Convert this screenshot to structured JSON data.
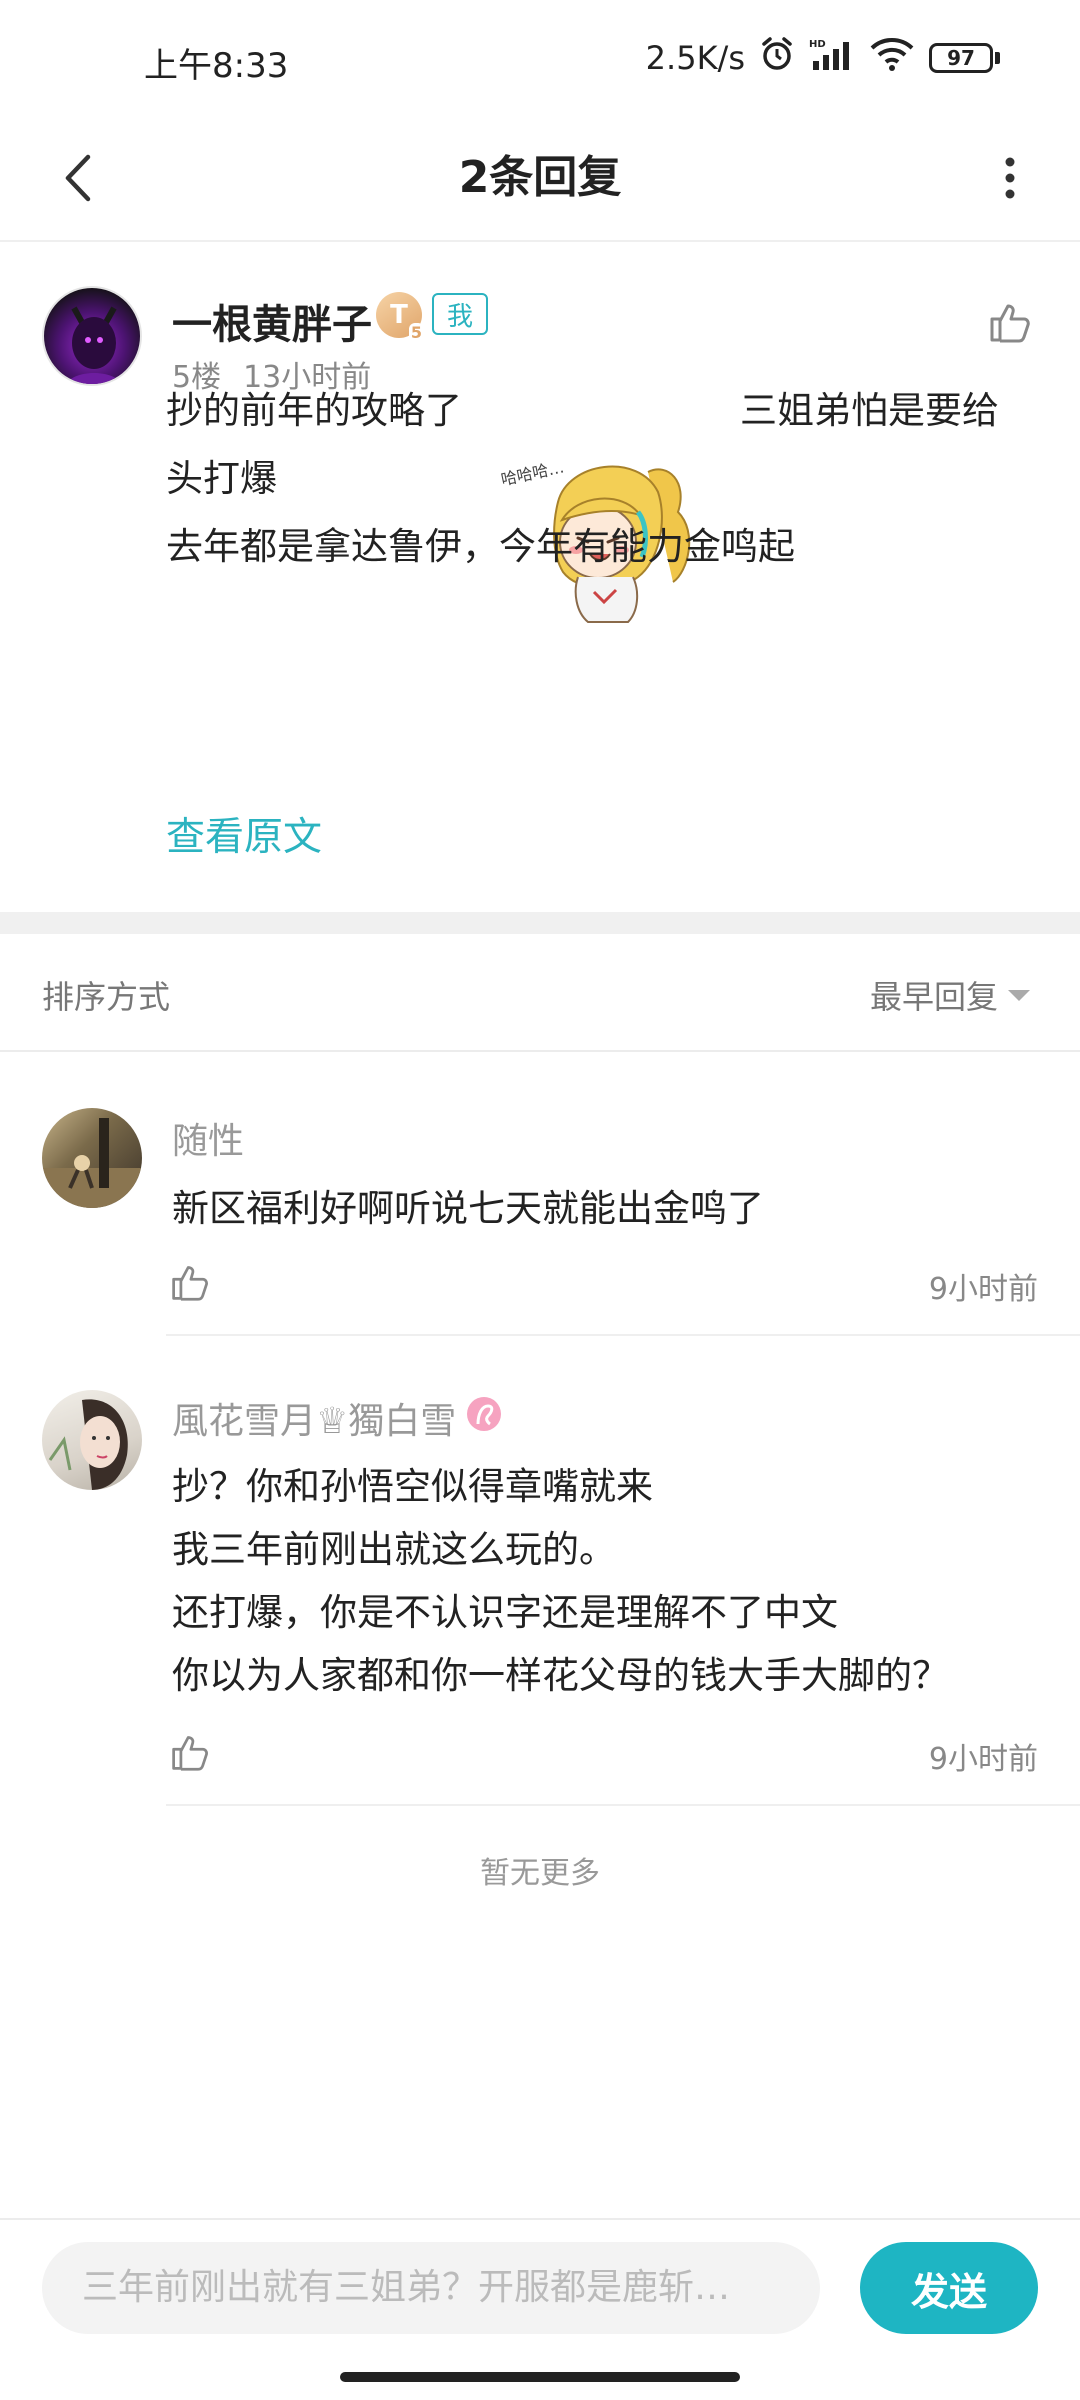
{
  "status_bar": {
    "time": "上午8:33",
    "network_speed": "2.5K/s",
    "battery": "97",
    "icons": [
      "alarm-icon",
      "hd-signal-icon",
      "wifi-icon",
      "battery-icon"
    ]
  },
  "header": {
    "title": "2条回复",
    "back_icon": "chevron-left-icon",
    "more_icon": "more-vertical-icon"
  },
  "post": {
    "author": "一根黄胖子",
    "level_badge": "T",
    "level_sub": "5",
    "me_badge": "我",
    "floor": "5楼",
    "time": "13小时前",
    "text_line1_before": "抄的前年的攻略了",
    "text_line1_after": "三姐弟怕是要给",
    "text_line2": "头打爆",
    "text_line3": "去年都是拿达鲁伊，今年有能力金鸣起",
    "sticker_text": "哈哈哈…",
    "view_original": "查看原文"
  },
  "sort": {
    "label": "排序方式",
    "value": "最早回复"
  },
  "replies": [
    {
      "name": "随性",
      "lines": [
        "新区福利好啊听说七天就能出金鸣了"
      ],
      "time": "9小时前"
    },
    {
      "name": "風花雪月♕獨白雪",
      "lines": [
        "抄？你和孙悟空似得章嘴就来",
        "我三年前刚出就这么玩的。",
        "还打爆，你是不认识字还是理解不了中文",
        "你以为人家都和你一样花父母的钱大手大脚的？"
      ],
      "time": "9小时前"
    }
  ],
  "no_more": "暂无更多",
  "composer": {
    "value": "三年前刚出就有三姐弟？开服都是鹿斩…",
    "send_label": "发送"
  },
  "colors": {
    "accent": "#1eb5c3",
    "text": "#222222",
    "muted": "#888888"
  }
}
